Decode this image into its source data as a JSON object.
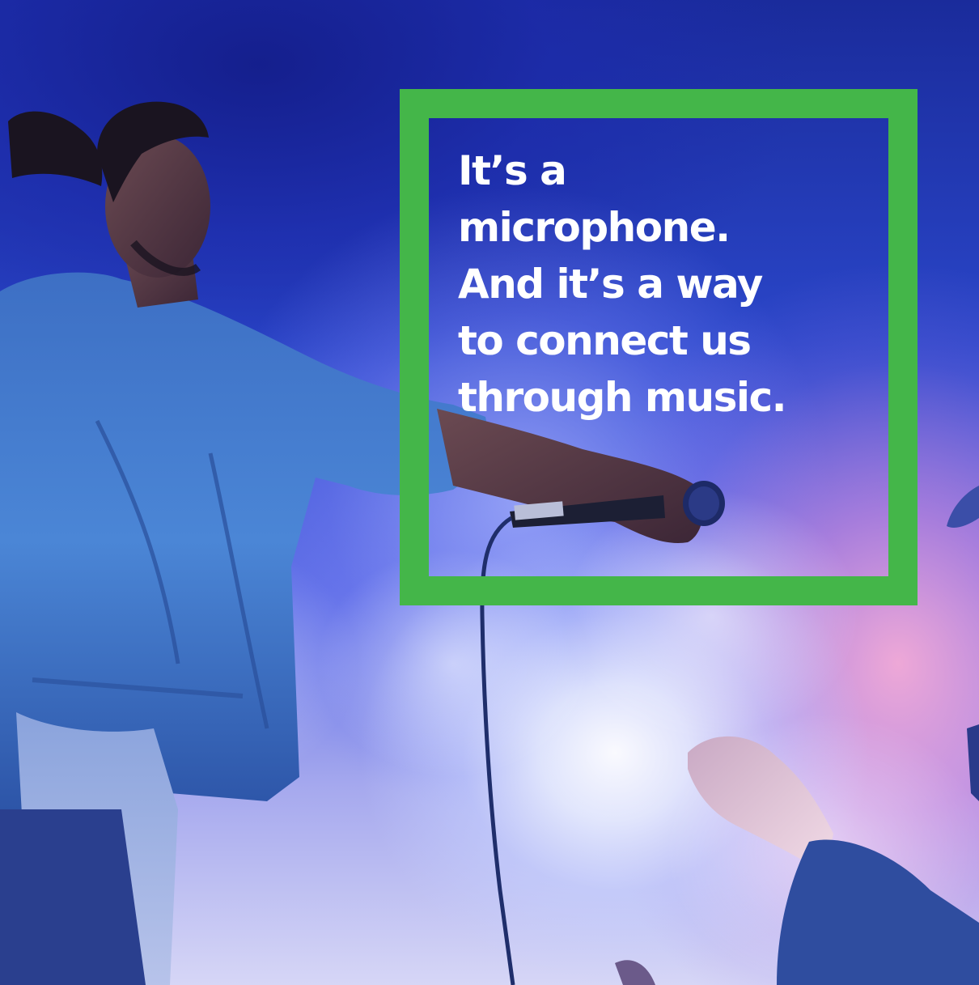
{
  "colors": {
    "frame": "#44b649",
    "headline_text": "#ffffff",
    "background_deep": "#1a2b9b",
    "background_glow": "#f4aad6"
  },
  "headline": {
    "lines": [
      "It’s a",
      "microphone.",
      "And it’s a way",
      "to connect us",
      "through music."
    ]
  }
}
